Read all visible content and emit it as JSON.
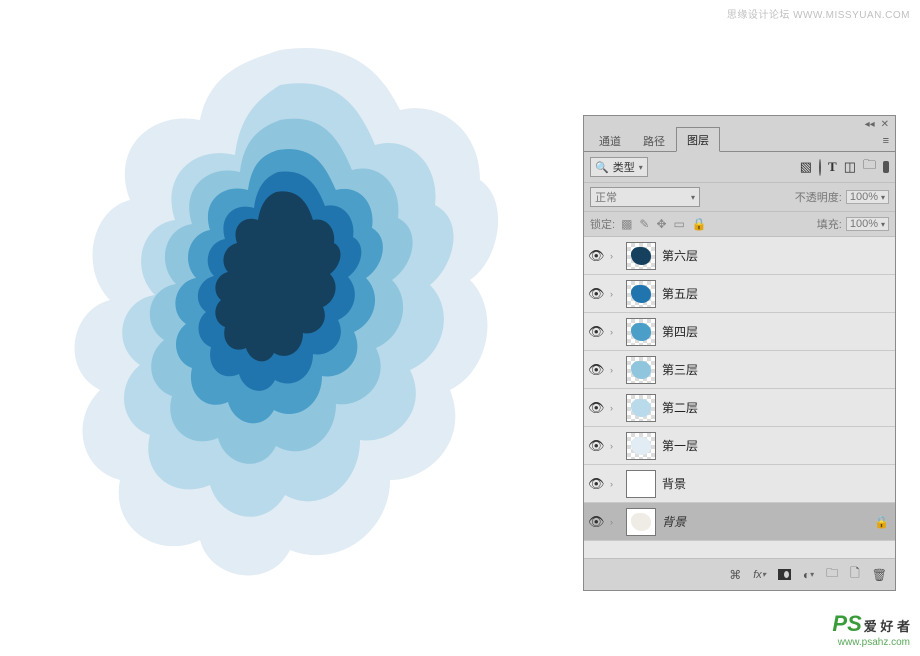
{
  "watermark_top": "思缘设计论坛 WWW.MISSYUAN.COM",
  "watermark_bottom": {
    "ps": "PS",
    "zh": "爱 好 者",
    "url": "www.psahz.com"
  },
  "artwork_colors": [
    "#e2ecf4",
    "#b9daea",
    "#8fc6de",
    "#4a9ec8",
    "#2175ae",
    "#16415e"
  ],
  "panel": {
    "collapse_icon": "◂◂",
    "close_icon": "✕",
    "menu_icon": "≡",
    "tabs": [
      "通道",
      "路径",
      "图层"
    ],
    "active_tab": 2,
    "filter": {
      "search_icon": "🔍",
      "label": "类型",
      "caret": "▾"
    },
    "filter_icon_names": [
      "image-icon",
      "adjustment-icon",
      "type-icon",
      "shape-icon",
      "smartobject-icon"
    ],
    "blend_mode": "正常",
    "opacity_label": "不透明度:",
    "opacity_value": "100%",
    "lock_label": "锁定:",
    "fill_label": "填充:",
    "fill_value": "100%",
    "layers": [
      {
        "name": "第六层",
        "visible": true,
        "thumb": "#16415e",
        "checker": true
      },
      {
        "name": "第五层",
        "visible": true,
        "thumb": "#2175ae",
        "checker": true
      },
      {
        "name": "第四层",
        "visible": true,
        "thumb": "#4a9ec8",
        "checker": true
      },
      {
        "name": "第三层",
        "visible": true,
        "thumb": "#8fc6de",
        "checker": true
      },
      {
        "name": "第二层",
        "visible": true,
        "thumb": "#b9daea",
        "checker": true
      },
      {
        "name": "第一层",
        "visible": true,
        "thumb": "#e2ecf4",
        "checker": true
      },
      {
        "name": "背景",
        "visible": true,
        "thumb": "#ffffff",
        "checker": false
      },
      {
        "name": "背景",
        "visible": true,
        "thumb": "#efece6",
        "checker": false,
        "locked": true,
        "italic": true,
        "selected": true
      }
    ],
    "footer_icons": [
      "link-icon",
      "fx-icon",
      "mask-icon",
      "adjust-icon",
      "group-icon",
      "new-icon",
      "trash-icon"
    ]
  }
}
